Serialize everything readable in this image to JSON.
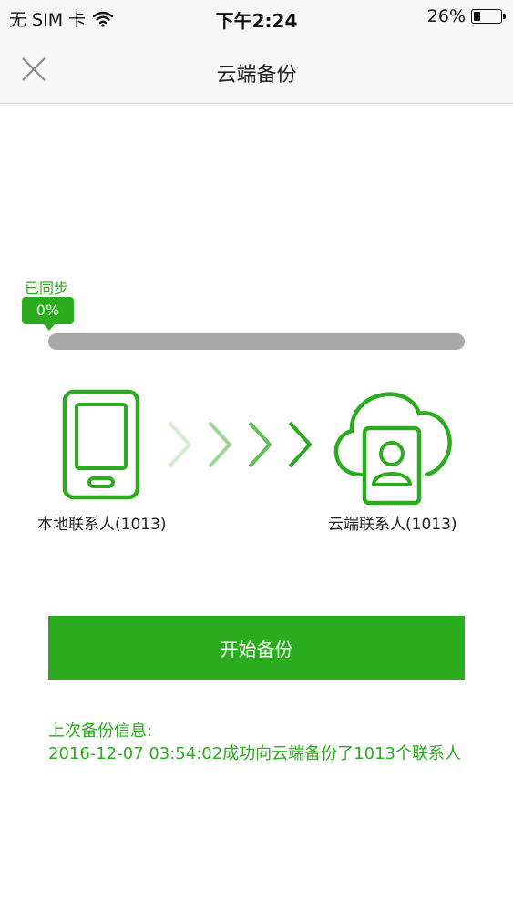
{
  "status_bar": {
    "carrier": "无 SIM 卡",
    "time": "下午2:24",
    "battery_percent": "26%",
    "battery_level": 0.26,
    "icons": [
      "wifi-icon",
      "battery-icon"
    ]
  },
  "nav": {
    "title": "云端备份",
    "close_icon": "close-icon"
  },
  "progress": {
    "synced_label": "已同步",
    "percent_text": "0%",
    "value": 0
  },
  "transfer": {
    "source_label": "本地联系人(1013)",
    "target_label": "云端联系人(1013)",
    "source_icon": "phone-icon",
    "target_icon": "cloud-contact-icon",
    "arrow_icon": "chevron-right-icon"
  },
  "actions": {
    "start_label": "开始备份"
  },
  "last_backup": {
    "heading": "上次备份信息:",
    "detail": "2016-12-07 03:54:02成功向云端备份了1013个联系人"
  },
  "colors": {
    "accent": "#2aac1e",
    "track": "#a8a8a8",
    "bar_bg": "#f7f7f7"
  }
}
